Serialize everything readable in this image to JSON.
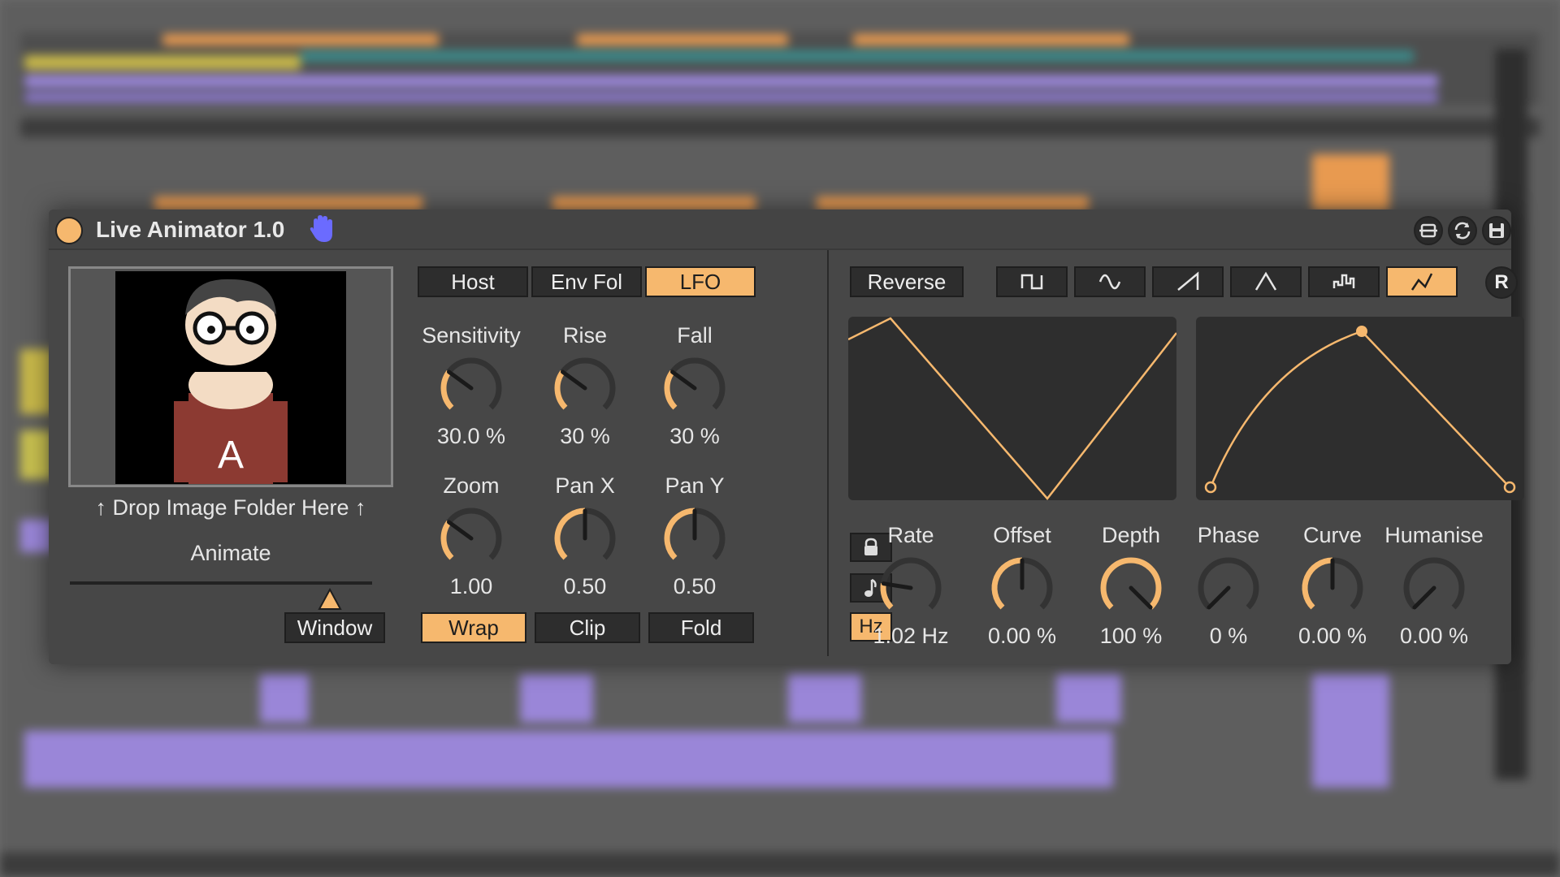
{
  "device": {
    "title": "Live Animator 1.0",
    "accent": "#f6b86e",
    "power_icon": "power-led-icon",
    "hand_icon": "hand-icon",
    "title_buttons": [
      "pin-icon",
      "refresh-icon",
      "save-icon"
    ]
  },
  "preview": {
    "drop_label": "↑ Drop Image Folder Here ↑",
    "animate_label": "Animate",
    "animate_value": 0.86,
    "window_button": "Window"
  },
  "source_tabs": [
    {
      "label": "Host",
      "active": false
    },
    {
      "label": "Env Fol",
      "active": false
    },
    {
      "label": "LFO",
      "active": true
    }
  ],
  "knobs_row1": [
    {
      "label": "Sensitivity",
      "value": "30.0 %",
      "level": 0.3
    },
    {
      "label": "Rise",
      "value": "30 %",
      "level": 0.3
    },
    {
      "label": "Fall",
      "value": "30 %",
      "level": 0.3
    }
  ],
  "knobs_row2": [
    {
      "label": "Zoom",
      "value": "1.00",
      "level": 0.3
    },
    {
      "label": "Pan X",
      "value": "0.50",
      "level": 0.5
    },
    {
      "label": "Pan Y",
      "value": "0.50",
      "level": 0.5
    }
  ],
  "mode_buttons": [
    {
      "label": "Wrap",
      "active": true
    },
    {
      "label": "Clip",
      "active": false
    },
    {
      "label": "Fold",
      "active": false
    }
  ],
  "lfo": {
    "reverse_label": "Reverse",
    "shapes": [
      {
        "icon": "square-wave-icon",
        "active": false
      },
      {
        "icon": "sine-wave-icon",
        "active": false
      },
      {
        "icon": "saw-wave-icon",
        "active": false
      },
      {
        "icon": "triangle-wave-icon",
        "active": false
      },
      {
        "icon": "random-wave-icon",
        "active": false
      },
      {
        "icon": "custom-wave-icon",
        "active": true
      }
    ],
    "r_button": "R",
    "side_buttons": [
      "lock-icon",
      "note-icon"
    ],
    "hz_button": "Hz",
    "knobs": [
      {
        "label": "Rate",
        "value": "1.02 Hz",
        "level": 0.2
      },
      {
        "label": "Offset",
        "value": "0.00 %",
        "level": 0.5
      },
      {
        "label": "Depth",
        "value": "100 %",
        "level": 1.0
      },
      {
        "label": "Phase",
        "value": "0 %",
        "level": 0.0
      },
      {
        "label": "Curve",
        "value": "0.00 %",
        "level": 0.5
      },
      {
        "label": "Humanise",
        "value": "0.00 %",
        "level": 0.0
      }
    ]
  }
}
